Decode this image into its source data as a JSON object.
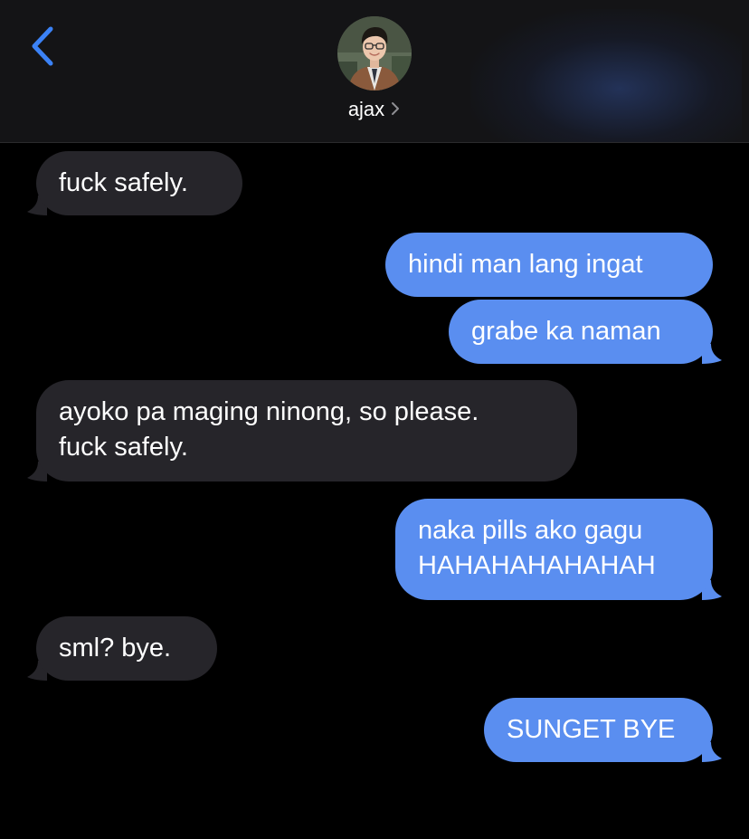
{
  "header": {
    "contact_name": "ajax",
    "colors": {
      "accent": "#3b82f6",
      "header_bg": "#141416"
    },
    "icons": {
      "back": "chevron-left-icon",
      "details": "chevron-right-icon",
      "avatar": "contact-photo"
    }
  },
  "messages": [
    {
      "direction": "incoming",
      "text": "fuck safely."
    },
    {
      "direction": "outgoing",
      "text": "hindi man lang ingat"
    },
    {
      "direction": "outgoing",
      "text": "grabe ka naman"
    },
    {
      "direction": "incoming",
      "text": "ayoko pa maging ninong, so please.\nfuck safely."
    },
    {
      "direction": "outgoing",
      "text": "naka pills ako gagu\nHAHAHAHAHAHAH"
    },
    {
      "direction": "incoming",
      "text": "sml? bye."
    },
    {
      "direction": "outgoing",
      "text": "SUNGET BYE"
    }
  ],
  "colors": {
    "incoming_bubble": "#26252a",
    "outgoing_bubble": "#5a8ef0",
    "background": "#000000"
  }
}
